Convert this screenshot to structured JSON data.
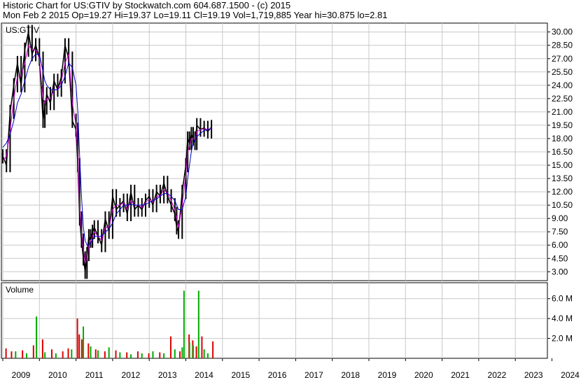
{
  "header": {
    "line1": "Historic Chart for US:GTIV by Stockwatch.com 604.687.1500 - (c) 2015",
    "line2": "Mon Feb  2 2015   Op=19.27   Hi=19.37   Lo=19.11   Cl=19.19   Vol=1,719,885   Year hi=30.875   lo=2.81"
  },
  "colors": {
    "price": "#000000",
    "ma_short": "#cc00cc",
    "ma_long": "#0000cc",
    "vol_up": "#00aa00",
    "vol_down": "#dd0000",
    "grid": "#c8c8c8"
  },
  "chart_data": [
    {
      "type": "line",
      "label": "US:GTIV",
      "ylim": [
        2.0,
        31.0
      ],
      "y_ticks": [
        "30.00",
        "28.50",
        "27.00",
        "25.50",
        "24.00",
        "22.50",
        "21.00",
        "19.50",
        "18.00",
        "16.50",
        "15.00",
        "13.50",
        "12.00",
        "10.50",
        "9.00",
        "7.50",
        "6.00",
        "4.50",
        "3.00"
      ],
      "x": [
        2009.0,
        2009.1,
        2009.2,
        2009.3,
        2009.4,
        2009.5,
        2009.6,
        2009.7,
        2009.8,
        2009.9,
        2010.0,
        2010.1,
        2010.15,
        2010.2,
        2010.3,
        2010.4,
        2010.5,
        2010.6,
        2010.7,
        2010.8,
        2010.9,
        2011.0,
        2011.05,
        2011.1,
        2011.15,
        2011.2,
        2011.25,
        2011.3,
        2011.35,
        2011.4,
        2011.45,
        2011.5,
        2011.6,
        2011.7,
        2011.8,
        2011.9,
        2012.0,
        2012.1,
        2012.2,
        2012.3,
        2012.4,
        2012.5,
        2012.6,
        2012.7,
        2012.8,
        2012.9,
        2013.0,
        2013.1,
        2013.2,
        2013.3,
        2013.4,
        2013.5,
        2013.6,
        2013.7,
        2013.75,
        2013.8,
        2013.9,
        2014.0,
        2014.05,
        2014.1,
        2014.15,
        2014.2,
        2014.25,
        2014.3,
        2014.4,
        2014.5,
        2014.6,
        2014.7
      ],
      "series": [
        {
          "name": "price",
          "values": [
            16.0,
            15.0,
            21.0,
            24.0,
            26.5,
            24.0,
            28.0,
            30.0,
            27.5,
            28.5,
            27.0,
            20.0,
            21.5,
            23.0,
            22.0,
            24.5,
            23.5,
            25.0,
            28.5,
            27.0,
            20.0,
            19.0,
            15.0,
            9.0,
            6.5,
            4.5,
            3.0,
            5.0,
            7.0,
            6.5,
            7.5,
            8.0,
            7.0,
            6.0,
            9.0,
            7.5,
            11.5,
            10.0,
            10.5,
            11.0,
            9.5,
            12.0,
            10.0,
            10.5,
            10.0,
            11.0,
            11.5,
            10.5,
            12.0,
            11.5,
            13.0,
            11.5,
            10.5,
            9.5,
            8.0,
            7.5,
            12.0,
            15.0,
            18.0,
            17.5,
            18.5,
            18.0,
            17.5,
            19.5,
            19.0,
            19.2,
            18.8,
            19.3
          ]
        },
        {
          "name": "ma_short",
          "values": [
            15.5,
            16.0,
            19.0,
            22.5,
            25.0,
            25.0,
            26.5,
            28.5,
            28.0,
            28.0,
            27.0,
            22.5,
            22.0,
            22.5,
            22.5,
            23.5,
            23.5,
            24.5,
            26.5,
            27.5,
            22.0,
            19.5,
            16.0,
            10.0,
            7.5,
            5.5,
            4.0,
            4.5,
            6.0,
            6.5,
            7.0,
            7.5,
            7.0,
            6.5,
            8.0,
            8.0,
            10.0,
            10.5,
            10.5,
            10.8,
            10.0,
            11.0,
            10.5,
            10.5,
            10.2,
            10.8,
            11.2,
            10.8,
            11.5,
            11.5,
            12.3,
            11.8,
            11.0,
            10.0,
            9.0,
            8.0,
            10.5,
            14.0,
            16.5,
            17.2,
            18.0,
            18.0,
            17.8,
            18.8,
            19.0,
            19.1,
            19.0,
            19.2
          ]
        },
        {
          "name": "ma_long",
          "values": [
            17.0,
            17.5,
            18.5,
            20.0,
            22.0,
            23.0,
            24.5,
            26.0,
            27.0,
            27.5,
            27.5,
            25.5,
            24.5,
            24.0,
            23.5,
            23.5,
            23.5,
            24.0,
            25.0,
            26.5,
            26.0,
            24.0,
            21.0,
            16.0,
            11.5,
            8.0,
            6.5,
            6.0,
            6.0,
            6.2,
            6.5,
            7.0,
            7.0,
            7.0,
            7.5,
            7.8,
            8.5,
            9.5,
            10.0,
            10.5,
            10.5,
            10.6,
            10.5,
            10.5,
            10.5,
            10.6,
            10.8,
            11.0,
            11.2,
            11.5,
            11.8,
            11.8,
            11.5,
            11.0,
            10.5,
            10.0,
            10.0,
            11.5,
            13.5,
            15.0,
            16.5,
            17.5,
            17.8,
            18.2,
            18.6,
            18.9,
            19.0,
            19.1
          ]
        }
      ]
    },
    {
      "type": "bar",
      "title": "Volume",
      "ylim": [
        0,
        7600000
      ],
      "y_ticks": [
        "6.0 M",
        "4.0 M",
        "2.0 M"
      ],
      "x_ticks": [
        "2009",
        "2010",
        "2011",
        "2012",
        "2013",
        "2014",
        "2015",
        "2016",
        "2017",
        "2018",
        "2019",
        "2020",
        "2021",
        "2022",
        "2023",
        "2024"
      ],
      "x": [
        2009.05,
        2009.2,
        2009.35,
        2009.5,
        2009.65,
        2009.8,
        2009.92,
        2010.05,
        2010.15,
        2010.3,
        2010.45,
        2010.6,
        2010.75,
        2010.88,
        2011.0,
        2011.05,
        2011.12,
        2011.2,
        2011.3,
        2011.4,
        2011.5,
        2011.6,
        2011.75,
        2011.9,
        2012.05,
        2012.2,
        2012.35,
        2012.5,
        2012.65,
        2012.8,
        2012.95,
        2013.1,
        2013.25,
        2013.4,
        2013.55,
        2013.7,
        2013.8,
        2013.9,
        2013.95,
        2014.05,
        2014.1,
        2014.15,
        2014.2,
        2014.25,
        2014.35,
        2014.4,
        2014.5,
        2014.6,
        2014.7
      ],
      "series": [
        {
          "name": "up",
          "values": [
            0,
            0,
            700000,
            0,
            500000,
            0,
            4200000,
            0,
            600000,
            0,
            500000,
            0,
            0,
            900000,
            0,
            0,
            0,
            3200000,
            0,
            1200000,
            0,
            800000,
            0,
            1100000,
            0,
            600000,
            0,
            400000,
            0,
            500000,
            0,
            700000,
            0,
            500000,
            0,
            900000,
            0,
            1100000,
            6800000,
            0,
            1600000,
            0,
            1300000,
            0,
            6800000,
            0,
            900000,
            500000,
            0
          ]
        },
        {
          "name": "down",
          "values": [
            1000000,
            700000,
            0,
            800000,
            0,
            1300000,
            0,
            1900000,
            0,
            900000,
            0,
            700000,
            1000000,
            0,
            4000000,
            2400000,
            1900000,
            0,
            1500000,
            0,
            900000,
            0,
            700000,
            0,
            800000,
            0,
            600000,
            0,
            700000,
            0,
            500000,
            0,
            600000,
            0,
            2200000,
            0,
            700000,
            0,
            0,
            2400000,
            0,
            1800000,
            0,
            1200000,
            0,
            2200000,
            0,
            0,
            1700000
          ]
        }
      ]
    }
  ]
}
